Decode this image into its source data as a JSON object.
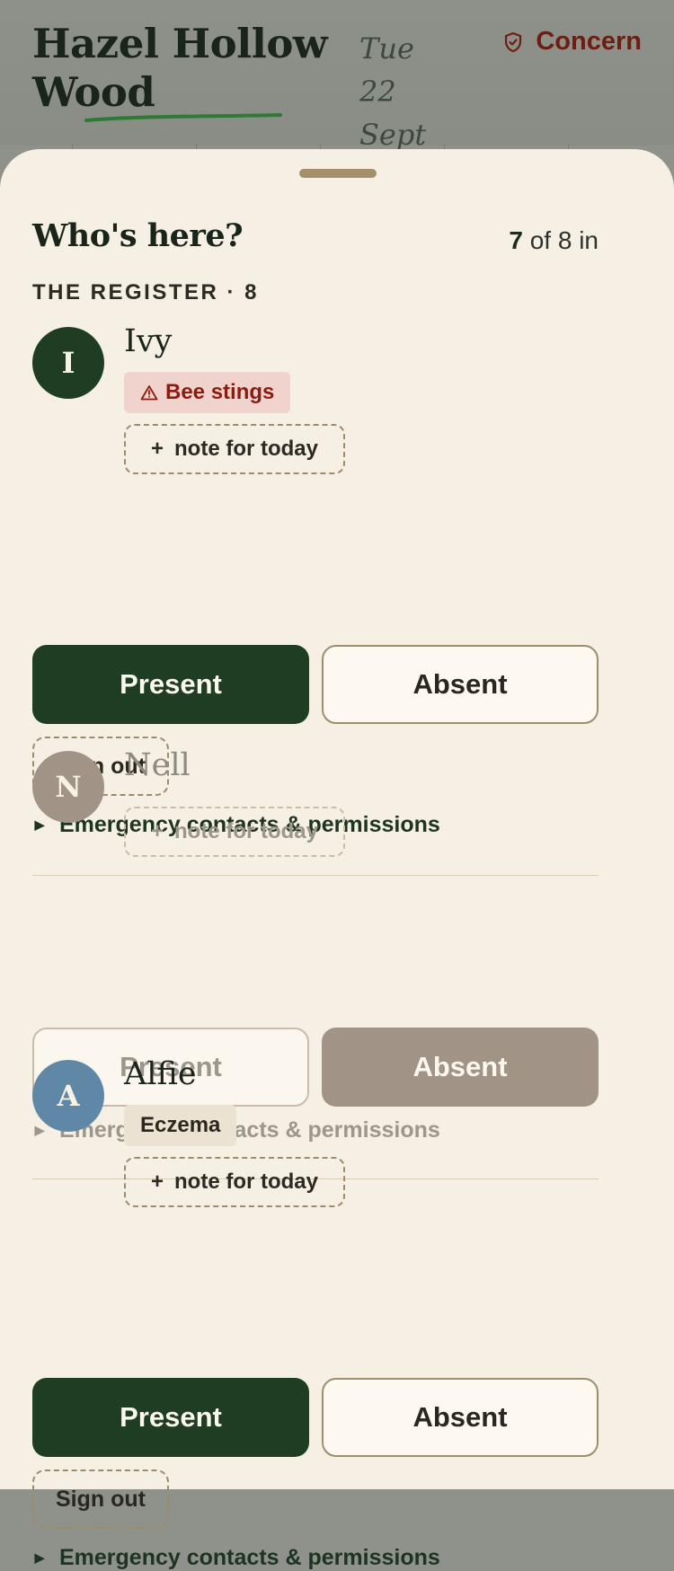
{
  "header": {
    "title_line1": "Hazel Hollow",
    "title_line2": "Wood",
    "date_line1": "Tue 22",
    "date_line2": "Sept",
    "concern_label": "Concern"
  },
  "sheet": {
    "title": "Who's here?",
    "count_present": "7",
    "count_suffix": "of 8 in",
    "register_label": "THE REGISTER · 8"
  },
  "children": [
    {
      "initial": "I",
      "name": "Ivy",
      "tag_label": "Bee stings",
      "note_plus": "+",
      "note_label": "note for today",
      "present_label": "Present",
      "absent_label": "Absent",
      "signout_label": "Sign out",
      "emergency_label": "Emergency contacts & permissions",
      "status": "present"
    },
    {
      "initial": "N",
      "name": "Nell",
      "note_plus": "+",
      "note_label": "note for today",
      "present_label": "Present",
      "absent_label": "Absent",
      "emergency_label": "Emergency contacts & permissions",
      "status": "absent"
    },
    {
      "initial": "A",
      "name": "Alfie",
      "tag_label": "Eczema",
      "note_plus": "+",
      "note_label": "note for today",
      "present_label": "Present",
      "absent_label": "Absent",
      "signout_label": "Sign out",
      "emergency_label": "Emergency contacts & permissions",
      "status": "present"
    }
  ],
  "colors": {
    "forest": "#1e3d22",
    "allergy_bg": "#f1d3ce",
    "allergy_text": "#8c1c10",
    "absent_fill": "#a19487",
    "sheet_bg": "#f5efe4",
    "avatar_ivy": "#1e3d22",
    "avatar_nell": "#a19487",
    "avatar_alfie": "#5f88a6"
  }
}
